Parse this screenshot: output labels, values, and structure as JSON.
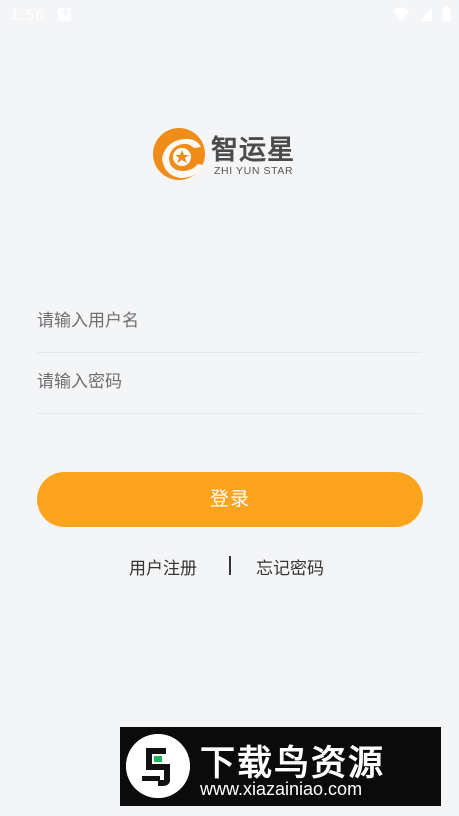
{
  "status_bar": {
    "time": "1:56"
  },
  "logo": {
    "name": "智运星",
    "subtitle": "ZHI YUN STAR",
    "brand_color": "#f08c1a"
  },
  "form": {
    "username_placeholder": "请输入用户名",
    "password_placeholder": "请输入密码"
  },
  "login_button": {
    "label": "登录",
    "color": "#fda41f"
  },
  "links": {
    "register": "用户注册",
    "forgot_password": "忘记密码"
  },
  "watermark": {
    "title": "下载鸟资源",
    "url": "www.xiazainiao.com"
  }
}
